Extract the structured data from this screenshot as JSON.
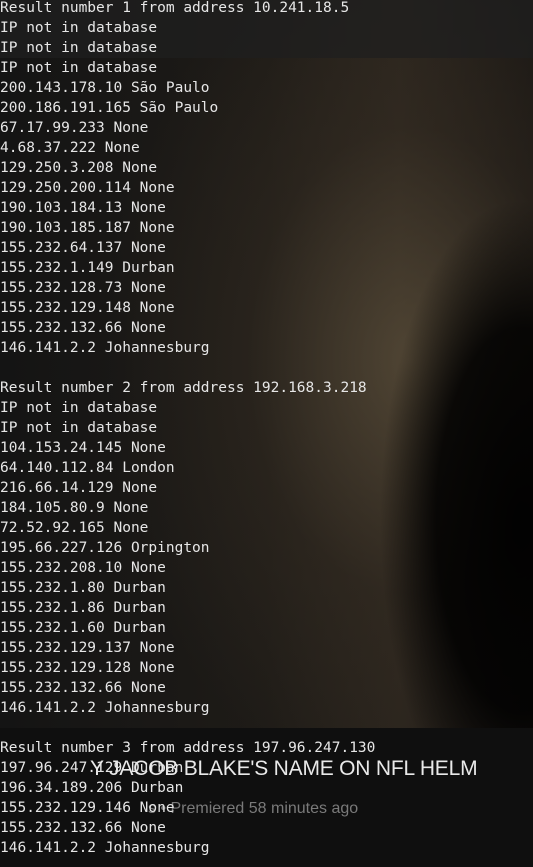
{
  "video": {
    "title_text": "Y JACOB BLAKE'S NAME ON NFL HELM",
    "meta_text": "s • Premiered 58 minutes ago"
  },
  "terminal": {
    "lines": [
      "Result number 1 from address 10.241.18.5",
      "IP not in database",
      "IP not in database",
      "IP not in database",
      "200.143.178.10 São Paulo",
      "200.186.191.165 São Paulo",
      "67.17.99.233 None",
      "4.68.37.222 None",
      "129.250.3.208 None",
      "129.250.200.114 None",
      "190.103.184.13 None",
      "190.103.185.187 None",
      "155.232.64.137 None",
      "155.232.1.149 Durban",
      "155.232.128.73 None",
      "155.232.129.148 None",
      "155.232.132.66 None",
      "146.141.2.2 Johannesburg",
      "",
      "Result number 2 from address 192.168.3.218",
      "IP not in database",
      "IP not in database",
      "104.153.24.145 None",
      "64.140.112.84 London",
      "216.66.14.129 None",
      "184.105.80.9 None",
      "72.52.92.165 None",
      "195.66.227.126 Orpington",
      "155.232.208.10 None",
      "155.232.1.80 Durban",
      "155.232.1.86 Durban",
      "155.232.1.60 Durban",
      "155.232.129.137 None",
      "155.232.129.128 None",
      "155.232.132.66 None",
      "146.141.2.2 Johannesburg",
      "",
      "Result number 3 from address 197.96.247.130",
      "197.96.247.129 Durban",
      "196.34.189.206 Durban",
      "155.232.129.146 None",
      "155.232.132.66 None",
      "146.141.2.2 Johannesburg"
    ]
  }
}
